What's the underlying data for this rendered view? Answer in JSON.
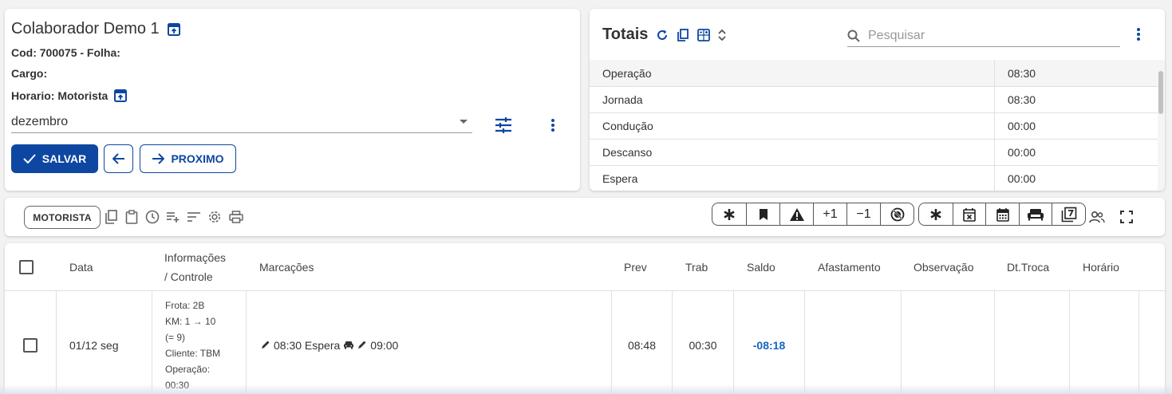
{
  "employee": {
    "name": "Colaborador Demo 1",
    "cod_line": "Cod: 700075 - Folha:",
    "cargo_line": "Cargo:",
    "horario_line": "Horario: Motorista",
    "month_selected": "dezembro",
    "save_label": "SALVAR",
    "next_label": "PROXIMO"
  },
  "totais": {
    "title": "Totais",
    "search_placeholder": "Pesquisar",
    "rows": [
      {
        "label": "Operação",
        "value": "08:30"
      },
      {
        "label": "Jornada",
        "value": "08:30"
      },
      {
        "label": "Condução",
        "value": "00:00"
      },
      {
        "label": "Descanso",
        "value": "00:00"
      },
      {
        "label": "Espera",
        "value": "00:00"
      }
    ]
  },
  "toolbar": {
    "chip_label": "MOTORISTA",
    "group1": [
      "asterisk-icon",
      "bookmark-icon",
      "warning-icon",
      "+1",
      "−1",
      "block-icon"
    ],
    "group2": [
      "asterisk-icon",
      "event-busy-icon",
      "calendar-icon",
      "sofa-icon",
      "filter-7-icon"
    ]
  },
  "table": {
    "headers": {
      "data": "Data",
      "info_1": "Informações",
      "info_2": "/ Controle",
      "marcacoes": "Marcações",
      "prev": "Prev",
      "trab": "Trab",
      "saldo": "Saldo",
      "afastamento": "Afastamento",
      "observacao": "Observação",
      "dt_troca": "Dt.Troca",
      "horario": "Horário"
    },
    "rows": [
      {
        "data": "01/12 seg",
        "info": [
          "Frota: 2B",
          "KM: 1 → 10",
          "(= 9)",
          "Cliente: TBM",
          "Operação:",
          "00:30"
        ],
        "marc_1": "08:30 Espera",
        "marc_2": "09:00",
        "prev": "08:48",
        "trab": "00:30",
        "saldo": "-08:18"
      }
    ]
  },
  "colors": {
    "primary": "#0d47a1",
    "saldo_negative": "#1565c0"
  }
}
